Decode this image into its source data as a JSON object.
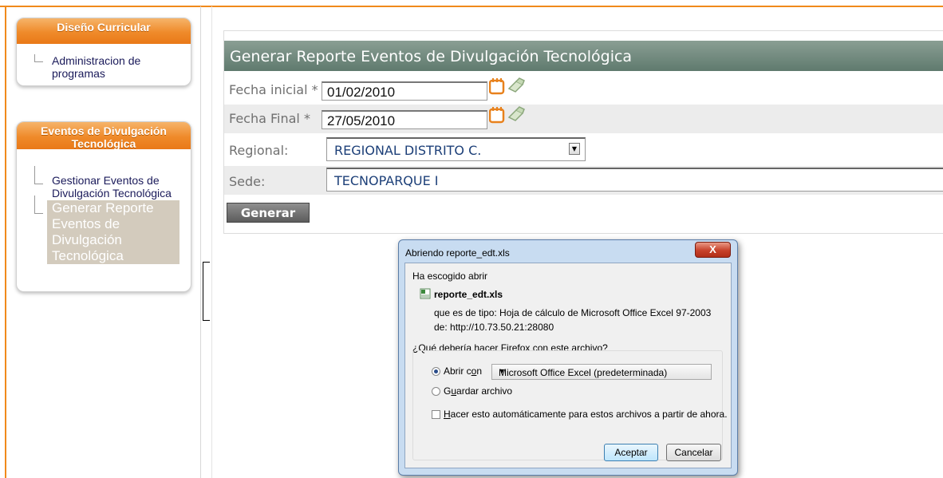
{
  "sidebar": {
    "sections": [
      {
        "title": "Diseño Curricular",
        "items": [
          {
            "label": "Administracion de programas"
          }
        ]
      },
      {
        "title": "Eventos de Divulgación Tecnológica",
        "items": [
          {
            "label": "Gestionar Eventos de Divulgación Tecnológica"
          },
          {
            "label": "Generar Reporte Eventos de Divulgación Tecnológica"
          }
        ]
      }
    ]
  },
  "form": {
    "title": "Generar Reporte Eventos de Divulgación Tecnológica",
    "fecha_inicial_label": "Fecha inicial *",
    "fecha_inicial_value": "01/02/2010",
    "fecha_final_label": "Fecha Final *",
    "fecha_final_value": "27/05/2010",
    "regional_label": "Regional:",
    "regional_value": "REGIONAL DISTRITO C.",
    "sede_label": "Sede:",
    "sede_value": "TECNOPARQUE I",
    "generar_label": "Generar"
  },
  "dialog": {
    "title": "Abriendo reporte_edt.xls",
    "close_label": "X",
    "intro": "Ha escogido abrir",
    "filename": "reporte_edt.xls",
    "type_line": "que es de tipo:  Hoja de cálculo de Microsoft Office Excel 97-2003",
    "from_line": "de: http://10.73.50.21:28080",
    "question": "¿Qué debería hacer Firefox con este archivo?",
    "open_with_pre": "Abrir c",
    "open_with_key": "o",
    "open_with_post": "n",
    "open_with_app": "Microsoft Office Excel (predeterminada)",
    "save_pre": "G",
    "save_key": "u",
    "save_post": "ardar archivo",
    "auto_key": "H",
    "auto_post": "acer esto automáticamente para estos archivos a partir de ahora.",
    "accept_label": "Aceptar",
    "cancel_label": "Cancelar"
  },
  "colors": {
    "accent_orange": "#f08a1c",
    "title_bar": "#5f7a6e"
  }
}
